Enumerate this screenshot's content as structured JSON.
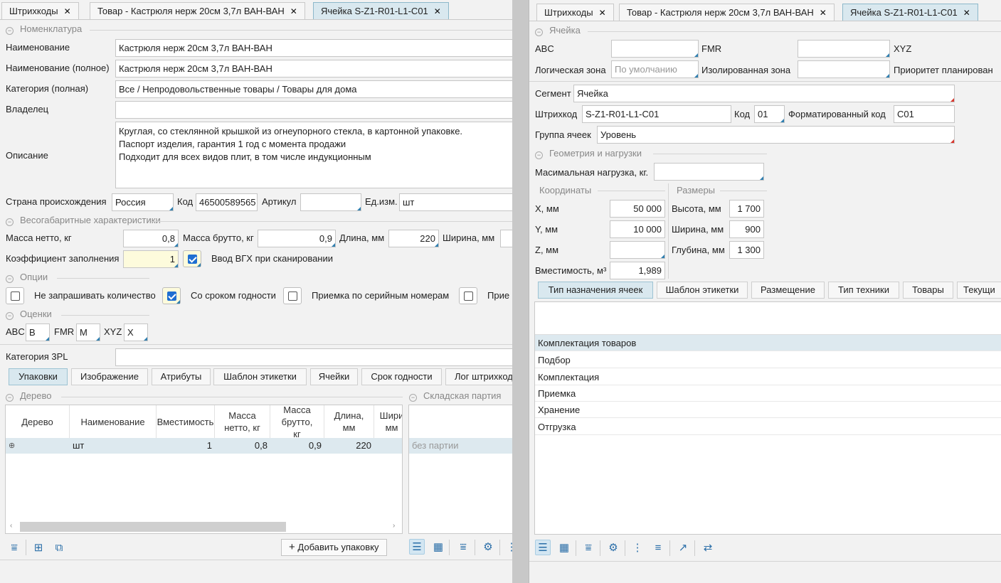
{
  "left": {
    "tabs": [
      {
        "label": "Штрихкоды"
      },
      {
        "label": "Товар - Кастрюля нерж 20см 3,7л ВАН-ВАН"
      },
      {
        "label": "Ячейка S-Z1-R01-L1-C01"
      }
    ],
    "nomenclature": {
      "section": "Номенклатура",
      "name_label": "Наименование",
      "name_value": "Кастрюля нерж 20см 3,7л ВАН-ВАН",
      "fullname_label": "Наименование (полное)",
      "fullname_value": "Кастрюля нерж 20см 3,7л ВАН-ВАН",
      "category_label": "Категория (полная)",
      "category_value": "Все / Непродовольственные товары / Товары для дома",
      "owner_label": "Владелец",
      "owner_value": "",
      "desc_label": "Описание",
      "desc_line1": "Круглая, со стеклянной крышкой из огнеупорного стекла, в картонной упаковке.",
      "desc_line2": "Паспорт изделия, гарантия 1 год с момента продажи",
      "desc_line3": "Подходит для всех видов плит, в том числе индукционным",
      "country_label": "Страна происхождения",
      "country_value": "Россия",
      "code_label": "Код",
      "code_value": "46500589565",
      "article_label": "Артикул",
      "article_value": "",
      "unit_label": "Ед.изм.",
      "unit_value": "шт"
    },
    "dims": {
      "section": "Весогабаритные характеристики",
      "net_label": "Масса нетто, кг",
      "net_value": "0,8",
      "gross_label": "Масса брутто, кг",
      "gross_value": "0,9",
      "length_label": "Длина, мм",
      "length_value": "220",
      "width_label": "Ширина, мм",
      "fill_label": "Коэффициент заполнения",
      "fill_value": "1",
      "vgh_label": "Ввод ВГХ при сканировании"
    },
    "options": {
      "section": "Опции",
      "opt1": "Не запрашивать количество",
      "opt2": "Со сроком годности",
      "opt3": "Приемка по серийным номерам",
      "opt4": "Прие"
    },
    "ratings": {
      "section": "Оценки",
      "abc_label": "ABC",
      "abc_value": "B",
      "fmr_label": "FMR",
      "fmr_value": "M",
      "xyz_label": "XYZ",
      "xyz_value": "X"
    },
    "cat3pl_label": "Категория 3PL",
    "subtabs": [
      "Упаковки",
      "Изображение",
      "Атрибуты",
      "Шаблон этикетки",
      "Ячейки",
      "Срок годности",
      "Лог штрихкод"
    ],
    "tree": {
      "section": "Дерево",
      "headers": [
        "Дерево",
        "Наименование",
        "Вместимость",
        "Масса нетто, кг",
        "Масса брутто, кг",
        "Длина, мм",
        "Шири мм"
      ],
      "row": {
        "name": "шт",
        "capacity": "1",
        "net": "0,8",
        "gross": "0,9",
        "length": "220"
      }
    },
    "batch": {
      "section": "Складская партия",
      "row": "без партии"
    },
    "add_pack_button": "Добавить упаковку"
  },
  "right": {
    "tabs": [
      {
        "label": "Штрихкоды"
      },
      {
        "label": "Товар - Кастрюля нерж 20см 3,7л ВАН-ВАН"
      },
      {
        "label": "Ячейка S-Z1-R01-L1-C01"
      }
    ],
    "cell": {
      "section": "Ячейка",
      "abc_label": "ABC",
      "fmr_label": "FMR",
      "xyz_label": "XYZ",
      "logzone_label": "Логическая зона",
      "logzone_placeholder": "По умолчанию",
      "isozone_label": "Изолированная зона",
      "priority_label": "Приоритет планирован",
      "segment_label": "Сегмент",
      "segment_value": "Ячейка",
      "barcode_label": "Штрихкод",
      "barcode_value": "S-Z1-R01-L1-C01",
      "code_label": "Код",
      "code_value": "01",
      "fcode_label": "Форматированный код",
      "fcode_value": "C01",
      "group_label": "Группа ячеек",
      "group_value": "Уровень"
    },
    "geometry": {
      "section": "Геометрия и нагрузки",
      "maxload_label": "Масимальная нагрузка, кг.",
      "coords_section": "Координаты",
      "sizes_section": "Размеры",
      "x_label": "X, мм",
      "x_value": "50 000",
      "y_label": "Y, мм",
      "y_value": "10 000",
      "z_label": "Z, мм",
      "z_value": "",
      "cap_label": "Вместимость, м³",
      "cap_value": "1,989",
      "h_label": "Высота, мм",
      "h_value": "1 700",
      "w_label": "Ширина, мм",
      "w_value": "900",
      "d_label": "Глубина, мм",
      "d_value": "1 300"
    },
    "subtabs": [
      "Тип назначения ячеек",
      "Шаблон этикетки",
      "Размещение",
      "Тип техники",
      "Товары",
      "Текущи"
    ],
    "list": [
      "Комплектация товаров",
      "Подбор",
      "Комплектация",
      "Приемка",
      "Хранение",
      "Отгрузка"
    ]
  }
}
